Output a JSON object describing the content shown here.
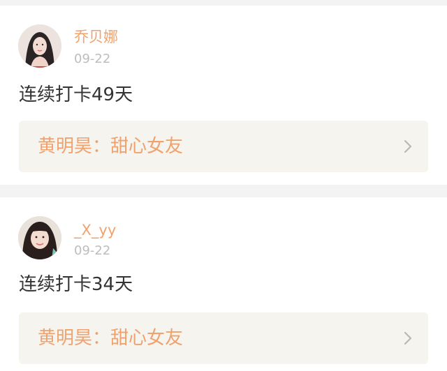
{
  "posts": [
    {
      "username": "乔贝娜",
      "date": "09-22",
      "text": "连续打卡49天",
      "song": "黄明昊：甜心女友"
    },
    {
      "username": "_X_yy",
      "date": "09-22",
      "text": "连续打卡34天",
      "song": "黄明昊：甜心女友"
    }
  ],
  "colors": {
    "accent": "#f0a26e",
    "muted": "#bdbdbd",
    "text": "#333333",
    "song_bg": "#f5f4ee",
    "page_bg": "#f3f3f3"
  }
}
